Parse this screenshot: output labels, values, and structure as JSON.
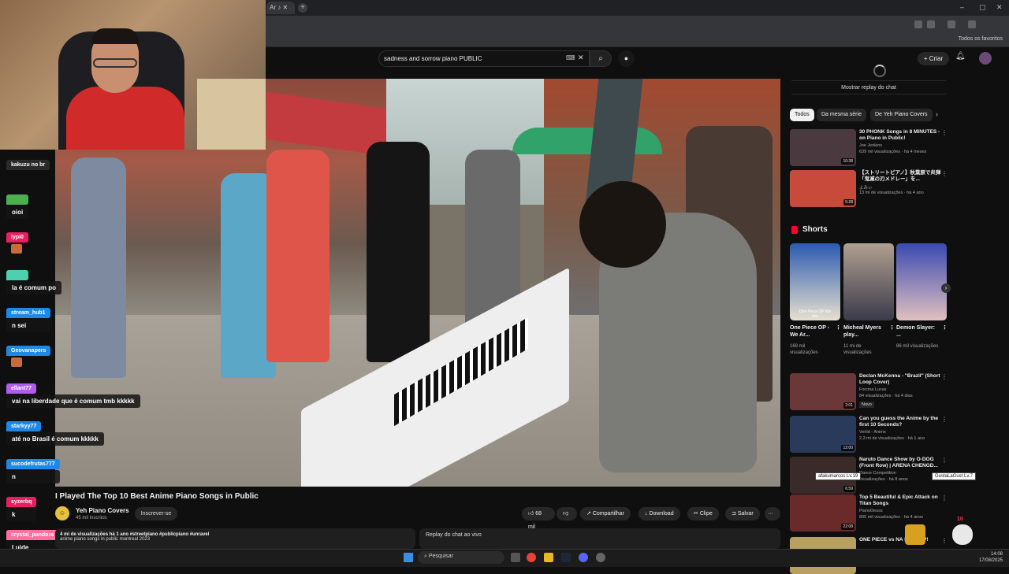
{
  "browser": {
    "tab_label": "Ar",
    "new_tab": "+",
    "bookmarks_label": "Todos os favoritos",
    "window_controls": [
      "–",
      "▢",
      "✕"
    ]
  },
  "youtube": {
    "search_value": "sadness and sorrow piano PUBLIC",
    "create_label": "Criar"
  },
  "video": {
    "title": "I Played The Top 10 Best Anime Piano Songs in Public",
    "channel": "Yeh Piano Covers",
    "subscribers": "45 mil inscritos",
    "subscribe_label": "Inscrever-se",
    "likes": "68 mil",
    "share_label": "Compartilhar",
    "download_label": "Download",
    "clip_label": "Clipe",
    "save_label": "Salvar",
    "more": "···",
    "desc_meta": "4 mi de visualizações  há 1 ano  #streetpiano #publicpiano #unravel",
    "desc_text": "anime piano songs in public montreal 2023",
    "chat_replay_label": "Replay do chat ao vivo"
  },
  "stream_chat": [
    {
      "name": "kakuzu no br",
      "text": "",
      "color": "#2a2a2a"
    },
    {
      "name": "",
      "text": "oioi",
      "color": "#4caf50"
    },
    {
      "name": "lypi0",
      "text": "",
      "color": "#e91e63",
      "emote": true
    },
    {
      "name": "",
      "text": "la é comum po",
      "color": "#4dd0b0"
    },
    {
      "name": "stream_hub1",
      "text": "n sei",
      "color": "#1e88e5"
    },
    {
      "name": "Geovanapers",
      "text": "",
      "color": "#1e88e5",
      "emote": true
    },
    {
      "name": "ellant77",
      "text": "vai na liberdade que é comum tmb kkkkk",
      "color": "#b15cf0"
    },
    {
      "name": "starkyy77",
      "text": "até no Brasil é comum kkkkk",
      "color": "#1e88e5"
    },
    {
      "name": "sucodefrutas777",
      "text": "n",
      "color": "#1e88e5"
    },
    {
      "name": "syzerbq",
      "text": "k",
      "color": "#e91e63"
    },
    {
      "name": "crystal_pandora",
      "text": "Luide",
      "color": "#ff6fa0"
    }
  ],
  "sidebar": {
    "replay_button": "Mostrar replay do chat",
    "chips": [
      "Todos",
      "Da mesma série",
      "De Yeh Piano Covers"
    ],
    "top_recs": [
      {
        "title": "30 PHONK Songs in 8 MINUTES - on Piano in Public!",
        "channel": "Joe Jenkins",
        "meta": "639 mil visualizações · há 4 meses",
        "duration": "10:38"
      },
      {
        "title": "【ストリートピアノ】秋葉原で炎弾「鬼滅の刃メドレー」を...",
        "channel": "よみぃ",
        "meta": "13 mi de visualizações · há 4 ano",
        "duration": "5:28"
      }
    ],
    "shorts_heading": "Shorts",
    "shorts": [
      {
        "title": "One Piece OP - We Ar...",
        "views": "169 mil visualizações",
        "overlay": "One Piece OP We Are"
      },
      {
        "title": "Micheal Myers play...",
        "views": "11 mi de visualizações",
        "overlay": ""
      },
      {
        "title": "Demon Slayer: ...",
        "views": "86 mil visualizações",
        "overlay": ""
      }
    ],
    "more_recs": [
      {
        "title": "Declan McKenna - \"Brazil\" (Short Loop Cover)",
        "channel": "Forcina Lucas",
        "meta": "84 visualizações · há 4 dias",
        "badge": "Novo",
        "duration": "2:01"
      },
      {
        "title": "Can you guess the Anime by the first 10 Seconds?",
        "channel": "Verlid - Anime",
        "meta": "2,3 mi de visualizações · há 1 ano",
        "duration": "12:00"
      },
      {
        "title": "Naruto Dance Show by O-DOG (Front Row) | ARENA CHENGD...",
        "channel": "Dance Competition",
        "meta": "visualizações · há 8 anos",
        "duration": "6:59"
      },
      {
        "title": "Top 5 Beautiful & Epic Attack on Titan Songs",
        "channel": "PianoDeuss",
        "meta": "895 mil visualizações · há 4 anos",
        "duration": "22:08"
      },
      {
        "title": "ONE PIECE vs NA MASHUP!",
        "channel": "",
        "meta": "",
        "duration": ""
      }
    ]
  },
  "overlays": {
    "player_tag1": "afakumarcos Lv.19",
    "player_tag2": "GustaLaGust Lv.7",
    "level": "10"
  },
  "taskbar": {
    "search_label": "Pesquisar",
    "time": "14:08",
    "date": "17/08/2025"
  }
}
